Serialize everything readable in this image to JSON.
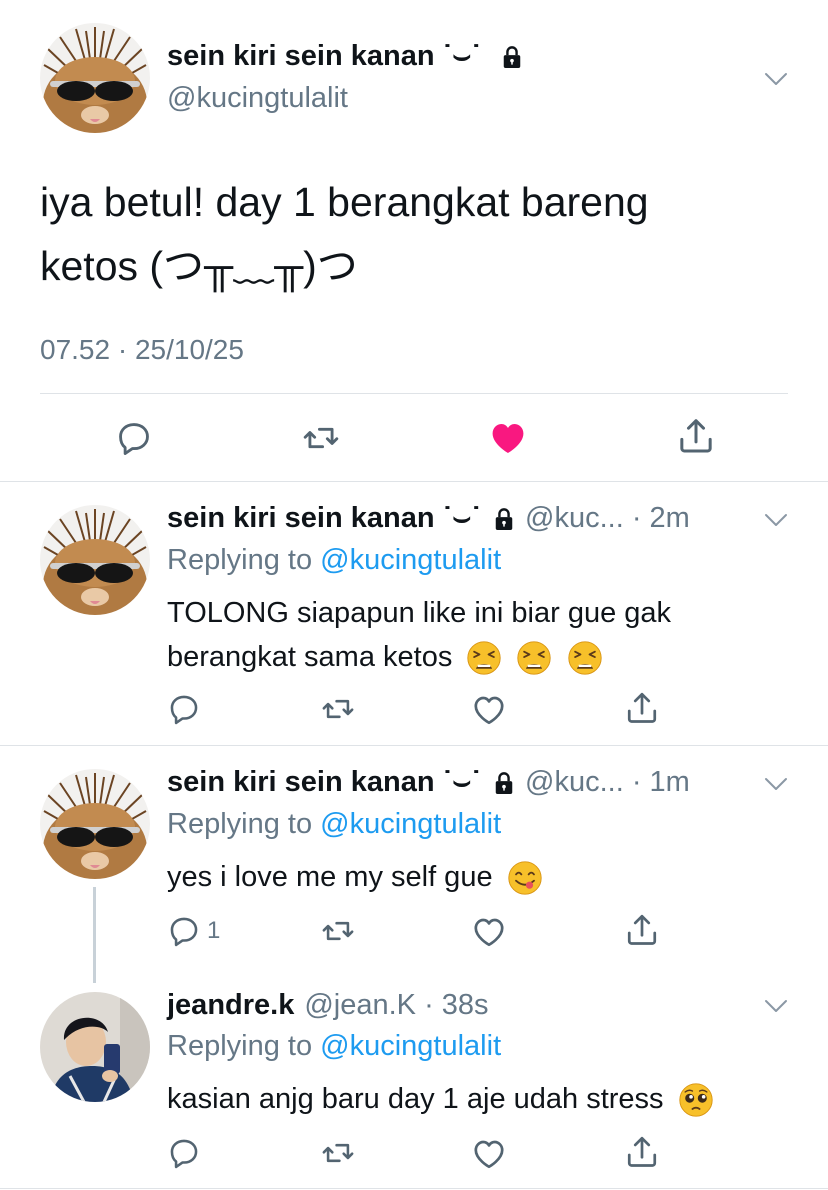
{
  "main_tweet": {
    "display_name": "sein kiri sein kanan ˙⌣˙",
    "handle": "@kucingtulalit",
    "text": "iya betul! day 1 berangkat bareng ketos (つ╥﹏╥)つ",
    "timestamp": "07.52 · 25/10/25",
    "liked": true
  },
  "replies": [
    {
      "display_name": "sein kiri sein kanan ˙⌣˙",
      "handle_time": "@kuc... · 2m",
      "replying_prefix": "Replying to ",
      "replying_to": "@kucingtulalit",
      "text": "TOLONG siapapun like ini biar gue gak berangkat sama ketos",
      "emoji": [
        "tired-face",
        "tired-face",
        "tired-face"
      ],
      "reply_count": ""
    },
    {
      "display_name": "sein kiri sein kanan ˙⌣˙",
      "handle_time": "@kuc... · 1m",
      "replying_prefix": "Replying to ",
      "replying_to": "@kucingtulalit",
      "text": "yes i love me my self gue",
      "emoji": [
        "yum-face"
      ],
      "reply_count": "1"
    },
    {
      "display_name": "jeandre.k",
      "handle_time": "@jean.K · 38s",
      "replying_prefix": "Replying to ",
      "replying_to": "@kucingtulalit",
      "text": "kasian anjg baru day 1 aje udah stress",
      "emoji": [
        "pleading-face"
      ],
      "reply_count": ""
    }
  ],
  "icons": {
    "reply": "reply-icon",
    "retweet": "retweet-icon",
    "like": "heart-icon",
    "share": "share-icon",
    "lock": "lock-icon",
    "more": "chevron-down-icon"
  },
  "colors": {
    "link": "#1d9bf0",
    "secondary": "#657786",
    "like": "#f91880"
  }
}
